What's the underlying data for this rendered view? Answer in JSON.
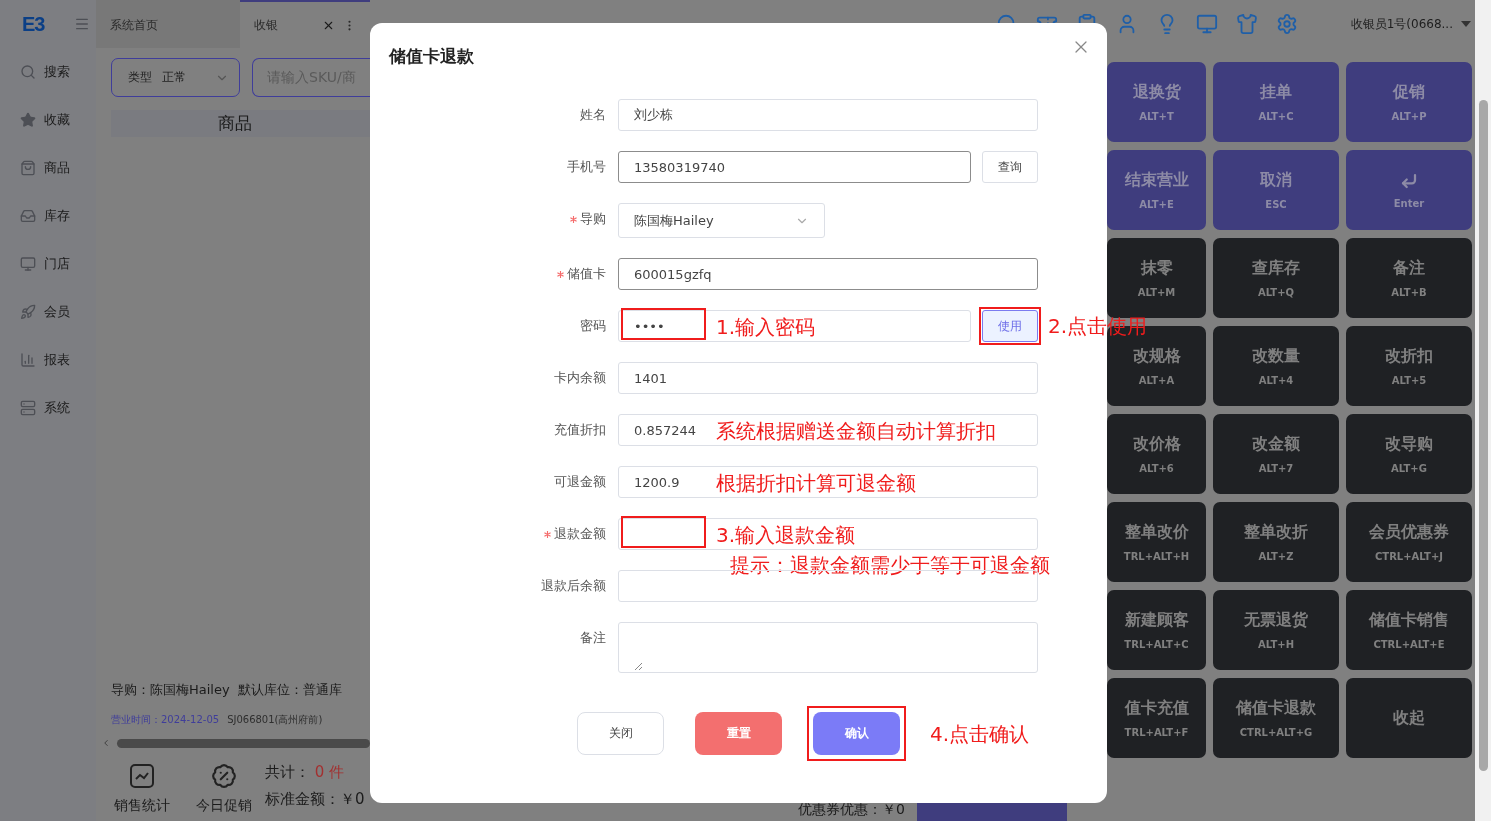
{
  "sidebar": {
    "logo": "E3",
    "items": [
      {
        "label": "搜索"
      },
      {
        "label": "收藏"
      },
      {
        "label": "商品"
      },
      {
        "label": "库存"
      },
      {
        "label": "门店"
      },
      {
        "label": "会员"
      },
      {
        "label": "报表"
      },
      {
        "label": "系统"
      }
    ]
  },
  "tabs": [
    {
      "label": "系统首页",
      "selected": false
    },
    {
      "label": "收银",
      "selected": true
    }
  ],
  "toolbar": {
    "user": "收银员1号(0668..."
  },
  "filter": {
    "type_label": "类型",
    "type_value": "正常",
    "search_placeholder": "请输入SKU/商"
  },
  "table": {
    "columns": [
      "商品"
    ]
  },
  "info": {
    "guide": "导购：陈国梅Hailey",
    "location": "默认库位：普通库",
    "business_time": "营业时间：2024-12-05",
    "store": "SJ066801(高州府前)"
  },
  "footer": {
    "actions": [
      {
        "label": "销售统计"
      },
      {
        "label": "今日促销"
      }
    ],
    "total_label": "共计：",
    "total_value": "0 件",
    "standard": "标准金额：￥0",
    "coupon": "优惠券优惠：￥0"
  },
  "shortcuts": [
    {
      "label": "退换货",
      "key": "ALT+T",
      "kind": "primary"
    },
    {
      "label": "挂单",
      "key": "ALT+C",
      "kind": "primary"
    },
    {
      "label": "促销",
      "key": "ALT+P",
      "kind": "primary"
    },
    {
      "label": "结束营业",
      "key": "ALT+E",
      "kind": "primary"
    },
    {
      "label": "取消",
      "key": "ESC",
      "kind": "primary"
    },
    {
      "key": "Enter",
      "kind": "enter"
    },
    {
      "label": "抹零",
      "key": "ALT+M",
      "kind": "dark"
    },
    {
      "label": "查库存",
      "key": "ALT+Q",
      "kind": "dark"
    },
    {
      "label": "备注",
      "key": "ALT+B",
      "kind": "dark"
    },
    {
      "label": "改规格",
      "key": "ALT+A",
      "kind": "dark"
    },
    {
      "label": "改数量",
      "key": "ALT+4",
      "kind": "dark"
    },
    {
      "label": "改折扣",
      "key": "ALT+5",
      "kind": "dark"
    },
    {
      "label": "改价格",
      "key": "ALT+6",
      "kind": "dark"
    },
    {
      "label": "改金额",
      "key": "ALT+7",
      "kind": "dark"
    },
    {
      "label": "改导购",
      "key": "ALT+G",
      "kind": "dark"
    },
    {
      "label": "整单改价",
      "key": "TRL+ALT+H",
      "kind": "dark"
    },
    {
      "label": "整单改折",
      "key": "ALT+Z",
      "kind": "dark"
    },
    {
      "label": "会员优惠券",
      "key": "CTRL+ALT+J",
      "kind": "dark"
    },
    {
      "label": "新建顾客",
      "key": "TRL+ALT+C",
      "kind": "dark"
    },
    {
      "label": "无票退货",
      "key": "ALT+H",
      "kind": "dark"
    },
    {
      "label": "储值卡销售",
      "key": "CTRL+ALT+E",
      "kind": "dark"
    },
    {
      "label": "值卡充值",
      "key": "TRL+ALT+F",
      "kind": "dark"
    },
    {
      "label": "储值卡退款",
      "key": "CTRL+ALT+G",
      "kind": "dark"
    },
    {
      "label": "收起",
      "kind": "dark"
    }
  ],
  "dialog": {
    "title": "储值卡退款",
    "fields": [
      {
        "label": "姓名",
        "kind": "text",
        "value": "刘少栋",
        "required": false,
        "active": false
      },
      {
        "label": "手机号",
        "kind": "text",
        "value": "13580319740",
        "required": false,
        "active": true,
        "button": {
          "label": "查询",
          "highlighted": false
        }
      },
      {
        "label": "导购",
        "kind": "select",
        "value": "陈国梅Hailey",
        "required": true,
        "active": false
      },
      {
        "label": "储值卡",
        "kind": "text",
        "value": "600015gzfq",
        "required": true,
        "active": true
      },
      {
        "label": "密码",
        "kind": "text",
        "value": "••••",
        "required": false,
        "active": false,
        "marked": true,
        "note": "1.输入密码",
        "button": {
          "label": "使用",
          "highlighted": true,
          "note": "2.点击使用"
        }
      },
      {
        "label": "卡内余额",
        "kind": "text",
        "value": "1401",
        "required": false,
        "active": false
      },
      {
        "label": "充值折扣",
        "kind": "text",
        "value": "0.857244",
        "required": false,
        "active": false,
        "note": "系统根据赠送金额自动计算折扣"
      },
      {
        "label": "可退金额",
        "kind": "text",
        "value": "1200.9",
        "required": false,
        "active": false,
        "note": "根据折扣计算可退金额"
      },
      {
        "label": "退款金额",
        "kind": "text",
        "required": true,
        "active": false,
        "marked": true,
        "note": "3.输入退款金额",
        "hint": "提示：退款金额需少于等于可退金额"
      },
      {
        "label": "退款后余额",
        "kind": "text",
        "required": false,
        "active": false
      },
      {
        "label": "备注",
        "kind": "textarea",
        "required": false,
        "active": false
      }
    ],
    "buttons": [
      {
        "label": "关闭",
        "kind": "default",
        "highlighted": false
      },
      {
        "label": "重置",
        "kind": "danger",
        "highlighted": false
      },
      {
        "label": "确认",
        "kind": "primary",
        "highlighted": true,
        "note": "4.点击确认"
      }
    ]
  }
}
